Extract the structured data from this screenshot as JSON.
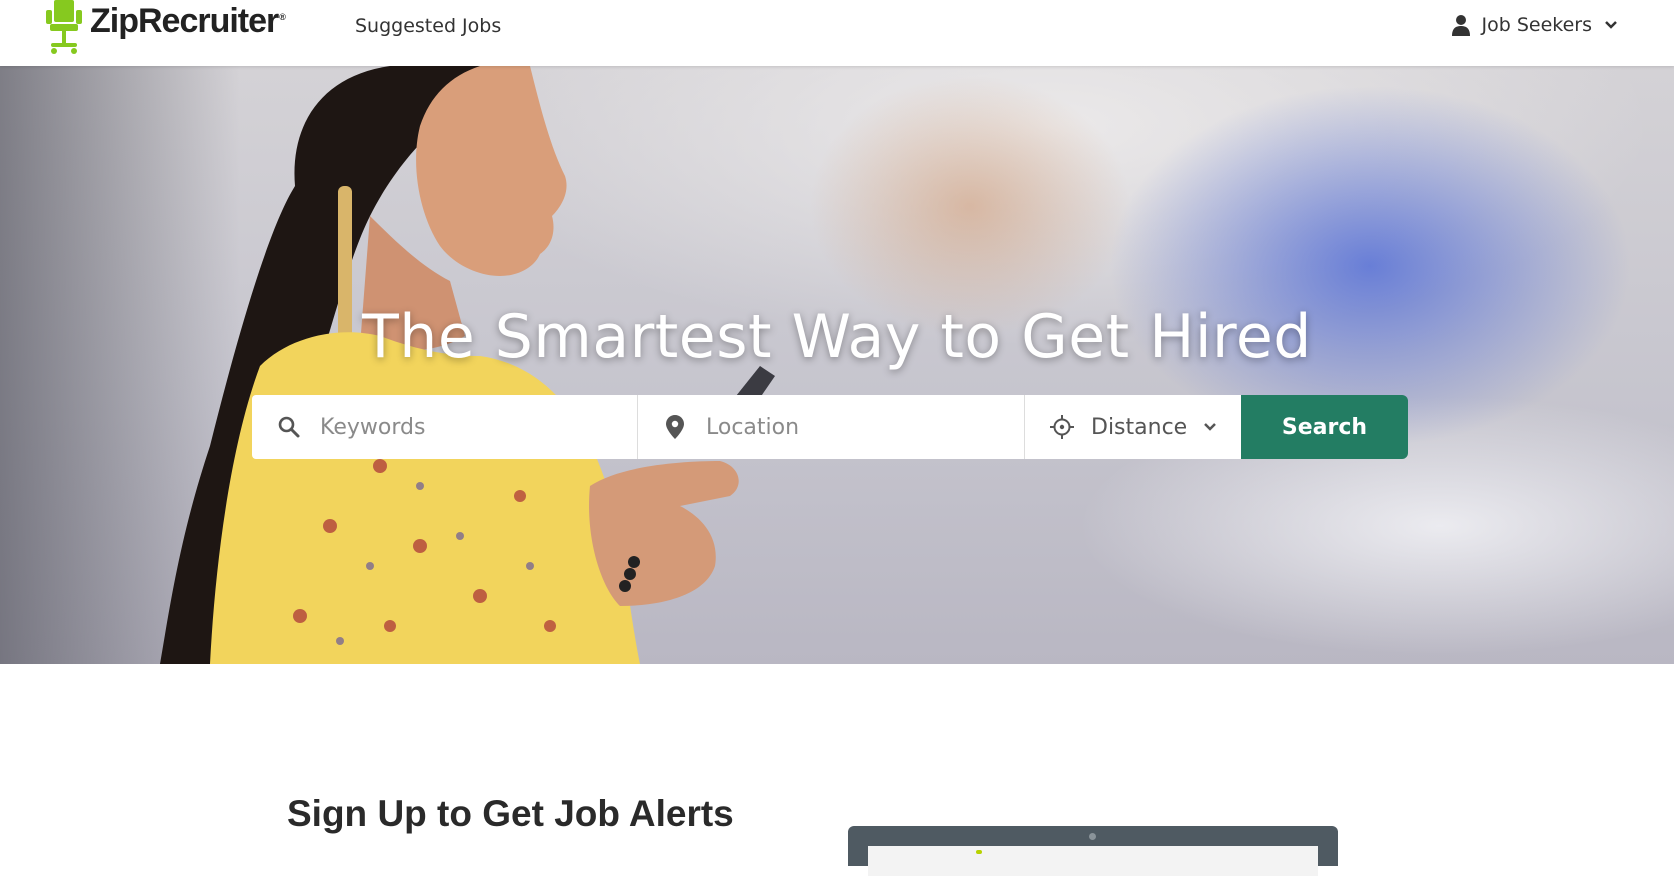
{
  "header": {
    "logo_text": "ZipRecruiter",
    "logo_mark": "®",
    "nav_suggested": "Suggested Jobs",
    "account_menu": "Job Seekers",
    "brand_color": "#86c91f"
  },
  "hero": {
    "title": "The Smartest Way to Get Hired",
    "search": {
      "keywords_placeholder": "Keywords",
      "location_placeholder": "Location",
      "distance_label": "Distance",
      "button_label": "Search",
      "button_color": "#237d63"
    }
  },
  "signup": {
    "title": "Sign Up to Get Job Alerts"
  },
  "icons": [
    "chair-logo-icon",
    "user-icon",
    "chevron-down-icon",
    "search-icon",
    "location-pin-icon",
    "crosshair-icon"
  ]
}
